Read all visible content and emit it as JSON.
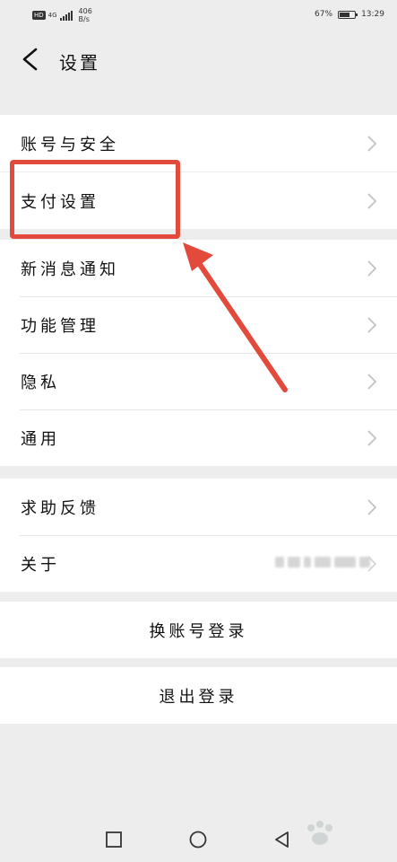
{
  "status_bar": {
    "hd": "HD",
    "network": "4G",
    "speed_value": "406",
    "speed_unit": "B/s",
    "battery_percent": "67%",
    "battery_level": 0.67,
    "time": "13:29"
  },
  "header": {
    "back_icon": "chevron-left-icon",
    "title": "设置"
  },
  "groups": {
    "g1": [
      {
        "label": "账号与安全"
      }
    ],
    "g2": [
      {
        "label": "支付设置"
      }
    ],
    "g3": [
      {
        "label": "新消息通知"
      },
      {
        "label": "功能管理"
      },
      {
        "label": "隐私"
      },
      {
        "label": "通用"
      }
    ],
    "g4": [
      {
        "label": "求助反馈"
      },
      {
        "label": "关于"
      }
    ]
  },
  "actions": {
    "switch_account": "换账号登录",
    "logout": "退出登录"
  },
  "annotation": {
    "color": "#e24a3b"
  },
  "nav": {
    "recent_icon": "square-icon",
    "home_icon": "circle-icon",
    "back_icon": "triangle-back-icon"
  }
}
